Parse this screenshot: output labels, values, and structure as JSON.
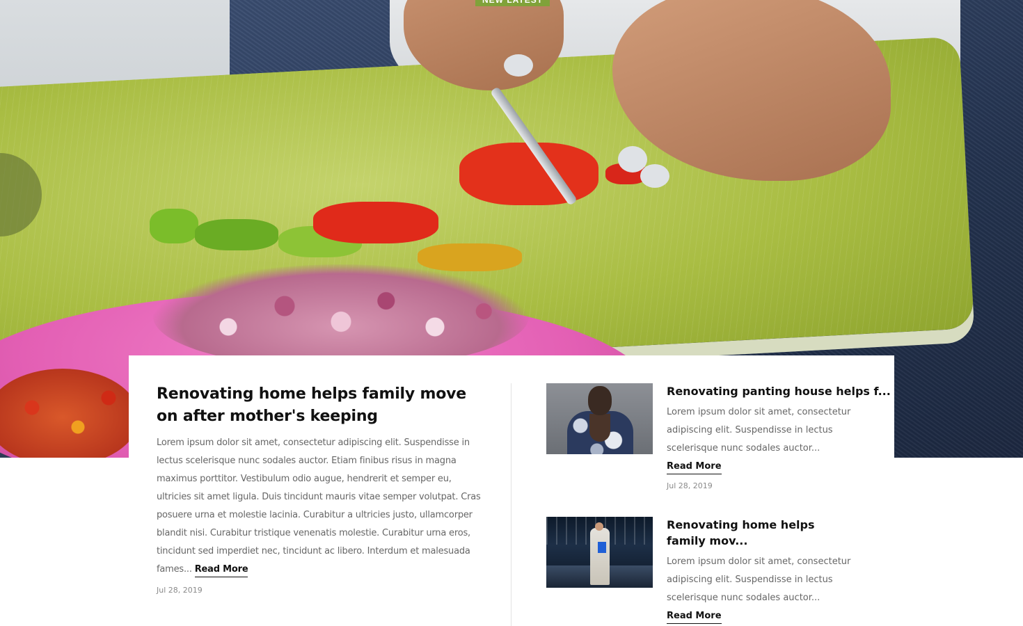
{
  "hero": {
    "badge": "NEW LATEST",
    "image_icon": "food-prep-photo"
  },
  "main_post": {
    "title": "Renovating home helps family move on after mother's keeping",
    "excerpt": "Lorem ipsum dolor sit amet, consectetur adipiscing elit. Suspendisse in lectus scelerisque nunc sodales auctor. Etiam finibus risus in magna maximus porttitor. Vestibulum odio augue, hendrerit et semper eu, ultricies sit amet ligula. Duis tincidunt mauris vitae semper volutpat. Cras posuere urna et molestie lacinia. Curabitur a ultricies justo, ullamcorper blandit nisi. Curabitur tristique venenatis molestie. Curabitur urna eros, tincidunt sed imperdiet nec, tincidunt ac libero. Interdum et malesuada fames...",
    "read_more": "Read More",
    "date": "Jul 28, 2019"
  },
  "side_posts": [
    {
      "title": "Renovating panting house helps f...",
      "excerpt": "Lorem ipsum dolor sit amet, consectetur adipiscing elit. Suspendisse in lectus scelerisque nunc sodales auctor...",
      "read_more": "Read More",
      "date": "Jul 28, 2019"
    },
    {
      "title": "Renovating home helps family mov...",
      "excerpt": "Lorem ipsum dolor sit amet, consectetur adipiscing elit. Suspendisse in lectus scelerisque nunc sodales auctor...",
      "read_more": "Read More"
    }
  ],
  "colors": {
    "badge_bg": "#80a23a",
    "title_text": "#111111",
    "body_text": "#666666",
    "date_text": "#8a8a8a"
  }
}
